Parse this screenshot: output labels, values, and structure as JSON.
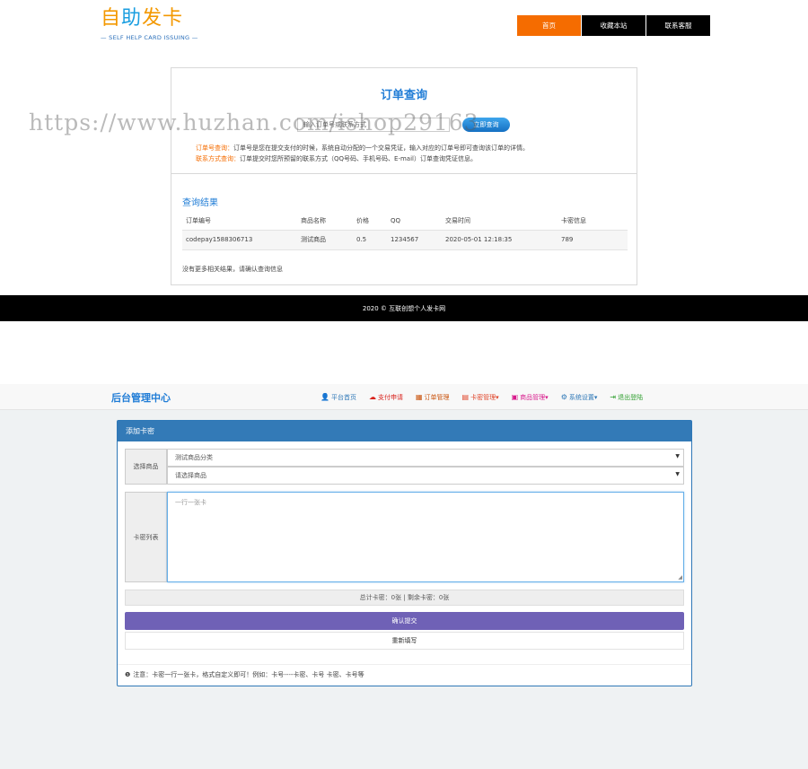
{
  "site": {
    "logo": {
      "part1": "自",
      "part2": "助",
      "part3": "发卡",
      "subtitle": "— SELF HELP CARD ISSUING —"
    },
    "nav": [
      {
        "label": "首页",
        "active": true
      },
      {
        "label": "收藏本站",
        "active": false
      },
      {
        "label": "联系客服",
        "active": false
      }
    ],
    "query": {
      "title": "订单查询",
      "input_placeholder": "输入订单号或联系方式",
      "button": "立即查询",
      "tip1_key": "订单号查询：",
      "tip1_text": "订单号是您在提交支付的时候，系统自动分配的一个交易凭证，输入对应的订单号即可查询该订单的详情。",
      "tip2_key": "联系方式查询：",
      "tip2_text": "订单提交时您所预留的联系方式（QQ号码、手机号码、E-mail）订单查询凭证信息。"
    },
    "results": {
      "title": "查询结果",
      "columns": [
        "订单编号",
        "商品名称",
        "价格",
        "QQ",
        "交易时间",
        "卡密信息"
      ],
      "rows": [
        [
          "codepay1588306713",
          "测试商品",
          "0.5",
          "1234567",
          "2020-05-01 12:18:35",
          "789"
        ]
      ],
      "note": "没有更多相关结果，请确认查询信息"
    },
    "footer": "2020 © 互联创想个人发卡网",
    "watermark": "https://www.huzhan.com/ishop29163"
  },
  "admin": {
    "brand": "后台管理中心",
    "menu": [
      {
        "label": "平台首页",
        "icon": "user-icon",
        "glyph": "👤",
        "color": "#2f78b7"
      },
      {
        "label": "支付申请",
        "icon": "cloud-icon",
        "glyph": "☁",
        "color": "#d9221c"
      },
      {
        "label": "订单管理",
        "icon": "book-icon",
        "glyph": "▦",
        "color": "#c9530d"
      },
      {
        "label": "卡密管理▾",
        "icon": "list-icon",
        "glyph": "▤",
        "color": "#e0452a"
      },
      {
        "label": "商品管理▾",
        "icon": "grid-icon",
        "glyph": "▣",
        "color": "#d81b8c"
      },
      {
        "label": "系统设置▾",
        "icon": "gear-icon",
        "glyph": "⚙",
        "color": "#2f78b7"
      },
      {
        "label": "退出登陆",
        "icon": "logout-icon",
        "glyph": "⇥",
        "color": "#2e9e2e"
      }
    ],
    "panel": {
      "title": "添加卡密",
      "select_label": "选择商品",
      "category_value": "测试商品分类",
      "product_value": "请选择商品",
      "cards_label": "卡密列表",
      "cards_placeholder": "一行一张卡",
      "stats": "总计卡密：0张 | 剩余卡密：0张",
      "submit": "确认提交",
      "reset": "重新填写",
      "note": "注意：卡密一行一张卡，格式自定义即可！例如：卡号----卡密、卡号 卡密、卡号等"
    }
  },
  "colors": {
    "orange": "#f56c00",
    "blue": "#1f7cd6",
    "panel_blue": "#337ab7",
    "purple": "#6f61b6"
  }
}
